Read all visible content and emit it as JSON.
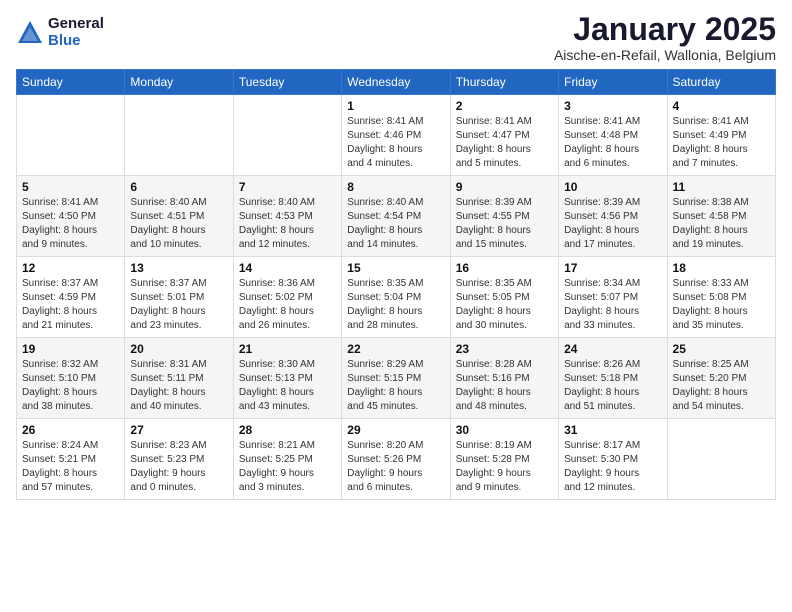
{
  "logo": {
    "general": "General",
    "blue": "Blue"
  },
  "header": {
    "month": "January 2025",
    "location": "Aische-en-Refail, Wallonia, Belgium"
  },
  "weekdays": [
    "Sunday",
    "Monday",
    "Tuesday",
    "Wednesday",
    "Thursday",
    "Friday",
    "Saturday"
  ],
  "weeks": [
    [
      {
        "day": "",
        "info": ""
      },
      {
        "day": "",
        "info": ""
      },
      {
        "day": "",
        "info": ""
      },
      {
        "day": "1",
        "info": "Sunrise: 8:41 AM\nSunset: 4:46 PM\nDaylight: 8 hours\nand 4 minutes."
      },
      {
        "day": "2",
        "info": "Sunrise: 8:41 AM\nSunset: 4:47 PM\nDaylight: 8 hours\nand 5 minutes."
      },
      {
        "day": "3",
        "info": "Sunrise: 8:41 AM\nSunset: 4:48 PM\nDaylight: 8 hours\nand 6 minutes."
      },
      {
        "day": "4",
        "info": "Sunrise: 8:41 AM\nSunset: 4:49 PM\nDaylight: 8 hours\nand 7 minutes."
      }
    ],
    [
      {
        "day": "5",
        "info": "Sunrise: 8:41 AM\nSunset: 4:50 PM\nDaylight: 8 hours\nand 9 minutes."
      },
      {
        "day": "6",
        "info": "Sunrise: 8:40 AM\nSunset: 4:51 PM\nDaylight: 8 hours\nand 10 minutes."
      },
      {
        "day": "7",
        "info": "Sunrise: 8:40 AM\nSunset: 4:53 PM\nDaylight: 8 hours\nand 12 minutes."
      },
      {
        "day": "8",
        "info": "Sunrise: 8:40 AM\nSunset: 4:54 PM\nDaylight: 8 hours\nand 14 minutes."
      },
      {
        "day": "9",
        "info": "Sunrise: 8:39 AM\nSunset: 4:55 PM\nDaylight: 8 hours\nand 15 minutes."
      },
      {
        "day": "10",
        "info": "Sunrise: 8:39 AM\nSunset: 4:56 PM\nDaylight: 8 hours\nand 17 minutes."
      },
      {
        "day": "11",
        "info": "Sunrise: 8:38 AM\nSunset: 4:58 PM\nDaylight: 8 hours\nand 19 minutes."
      }
    ],
    [
      {
        "day": "12",
        "info": "Sunrise: 8:37 AM\nSunset: 4:59 PM\nDaylight: 8 hours\nand 21 minutes."
      },
      {
        "day": "13",
        "info": "Sunrise: 8:37 AM\nSunset: 5:01 PM\nDaylight: 8 hours\nand 23 minutes."
      },
      {
        "day": "14",
        "info": "Sunrise: 8:36 AM\nSunset: 5:02 PM\nDaylight: 8 hours\nand 26 minutes."
      },
      {
        "day": "15",
        "info": "Sunrise: 8:35 AM\nSunset: 5:04 PM\nDaylight: 8 hours\nand 28 minutes."
      },
      {
        "day": "16",
        "info": "Sunrise: 8:35 AM\nSunset: 5:05 PM\nDaylight: 8 hours\nand 30 minutes."
      },
      {
        "day": "17",
        "info": "Sunrise: 8:34 AM\nSunset: 5:07 PM\nDaylight: 8 hours\nand 33 minutes."
      },
      {
        "day": "18",
        "info": "Sunrise: 8:33 AM\nSunset: 5:08 PM\nDaylight: 8 hours\nand 35 minutes."
      }
    ],
    [
      {
        "day": "19",
        "info": "Sunrise: 8:32 AM\nSunset: 5:10 PM\nDaylight: 8 hours\nand 38 minutes."
      },
      {
        "day": "20",
        "info": "Sunrise: 8:31 AM\nSunset: 5:11 PM\nDaylight: 8 hours\nand 40 minutes."
      },
      {
        "day": "21",
        "info": "Sunrise: 8:30 AM\nSunset: 5:13 PM\nDaylight: 8 hours\nand 43 minutes."
      },
      {
        "day": "22",
        "info": "Sunrise: 8:29 AM\nSunset: 5:15 PM\nDaylight: 8 hours\nand 45 minutes."
      },
      {
        "day": "23",
        "info": "Sunrise: 8:28 AM\nSunset: 5:16 PM\nDaylight: 8 hours\nand 48 minutes."
      },
      {
        "day": "24",
        "info": "Sunrise: 8:26 AM\nSunset: 5:18 PM\nDaylight: 8 hours\nand 51 minutes."
      },
      {
        "day": "25",
        "info": "Sunrise: 8:25 AM\nSunset: 5:20 PM\nDaylight: 8 hours\nand 54 minutes."
      }
    ],
    [
      {
        "day": "26",
        "info": "Sunrise: 8:24 AM\nSunset: 5:21 PM\nDaylight: 8 hours\nand 57 minutes."
      },
      {
        "day": "27",
        "info": "Sunrise: 8:23 AM\nSunset: 5:23 PM\nDaylight: 9 hours\nand 0 minutes."
      },
      {
        "day": "28",
        "info": "Sunrise: 8:21 AM\nSunset: 5:25 PM\nDaylight: 9 hours\nand 3 minutes."
      },
      {
        "day": "29",
        "info": "Sunrise: 8:20 AM\nSunset: 5:26 PM\nDaylight: 9 hours\nand 6 minutes."
      },
      {
        "day": "30",
        "info": "Sunrise: 8:19 AM\nSunset: 5:28 PM\nDaylight: 9 hours\nand 9 minutes."
      },
      {
        "day": "31",
        "info": "Sunrise: 8:17 AM\nSunset: 5:30 PM\nDaylight: 9 hours\nand 12 minutes."
      },
      {
        "day": "",
        "info": ""
      }
    ]
  ]
}
